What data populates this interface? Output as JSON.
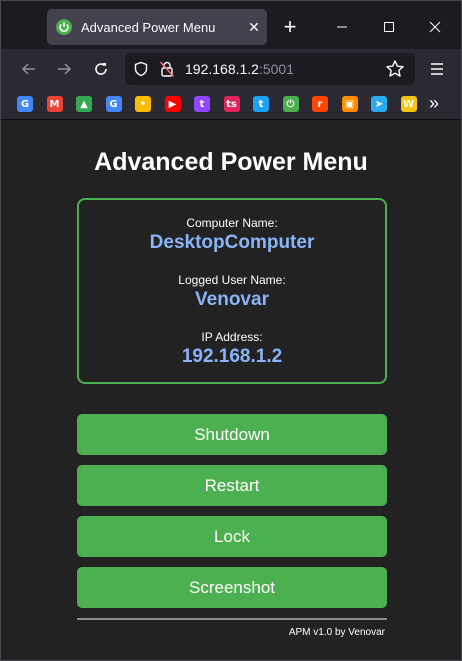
{
  "browser": {
    "tab": {
      "title": "Advanced Power Menu",
      "favicon": "power-icon",
      "close_glyph": "✕"
    },
    "new_tab_glyph": "+",
    "url": {
      "host": "192.168.1.2",
      "port": ":5001"
    },
    "bookmarks_more_glyph": "»"
  },
  "bookmarks": [
    {
      "name": "google",
      "letter": "G",
      "color": "#4285f4"
    },
    {
      "name": "gmail",
      "letter": "M",
      "color": "#ea4335"
    },
    {
      "name": "google-drive",
      "letter": "▲",
      "color": "#34a853"
    },
    {
      "name": "google-translate",
      "letter": "G",
      "color": "#4285f4"
    },
    {
      "name": "google-keep",
      "letter": "•",
      "color": "#fbbc04"
    },
    {
      "name": "youtube",
      "letter": "▶",
      "color": "#ff0000"
    },
    {
      "name": "twitch",
      "letter": "t",
      "color": "#9146ff"
    },
    {
      "name": "tipeee",
      "letter": "ts",
      "color": "#e0245e"
    },
    {
      "name": "twitter",
      "letter": "t",
      "color": "#1da1f2"
    },
    {
      "name": "power",
      "letter": "⏻",
      "color": "#4caf50"
    },
    {
      "name": "reddit",
      "letter": "r",
      "color": "#ff4500"
    },
    {
      "name": "tinkercad",
      "letter": "▣",
      "color": "#ff8c00"
    },
    {
      "name": "telegram",
      "letter": "➤",
      "color": "#2aabee"
    },
    {
      "name": "wk-logo",
      "letter": "W",
      "color": "#f5c518"
    }
  ],
  "page": {
    "title": "Advanced Power Menu",
    "computer_label": "Computer Name:",
    "computer_value": "DesktopComputer",
    "user_label": "Logged User Name:",
    "user_value": "Venovar",
    "ip_label": "IP Address:",
    "ip_value": "192.168.1.2",
    "buttons": {
      "shutdown": "Shutdown",
      "restart": "Restart",
      "lock": "Lock",
      "screenshot": "Screenshot"
    },
    "footer": "APM v1.0 by Venovar"
  },
  "colors": {
    "accent": "#4caf50",
    "value": "#8ab4f8",
    "page_bg": "#222222"
  }
}
